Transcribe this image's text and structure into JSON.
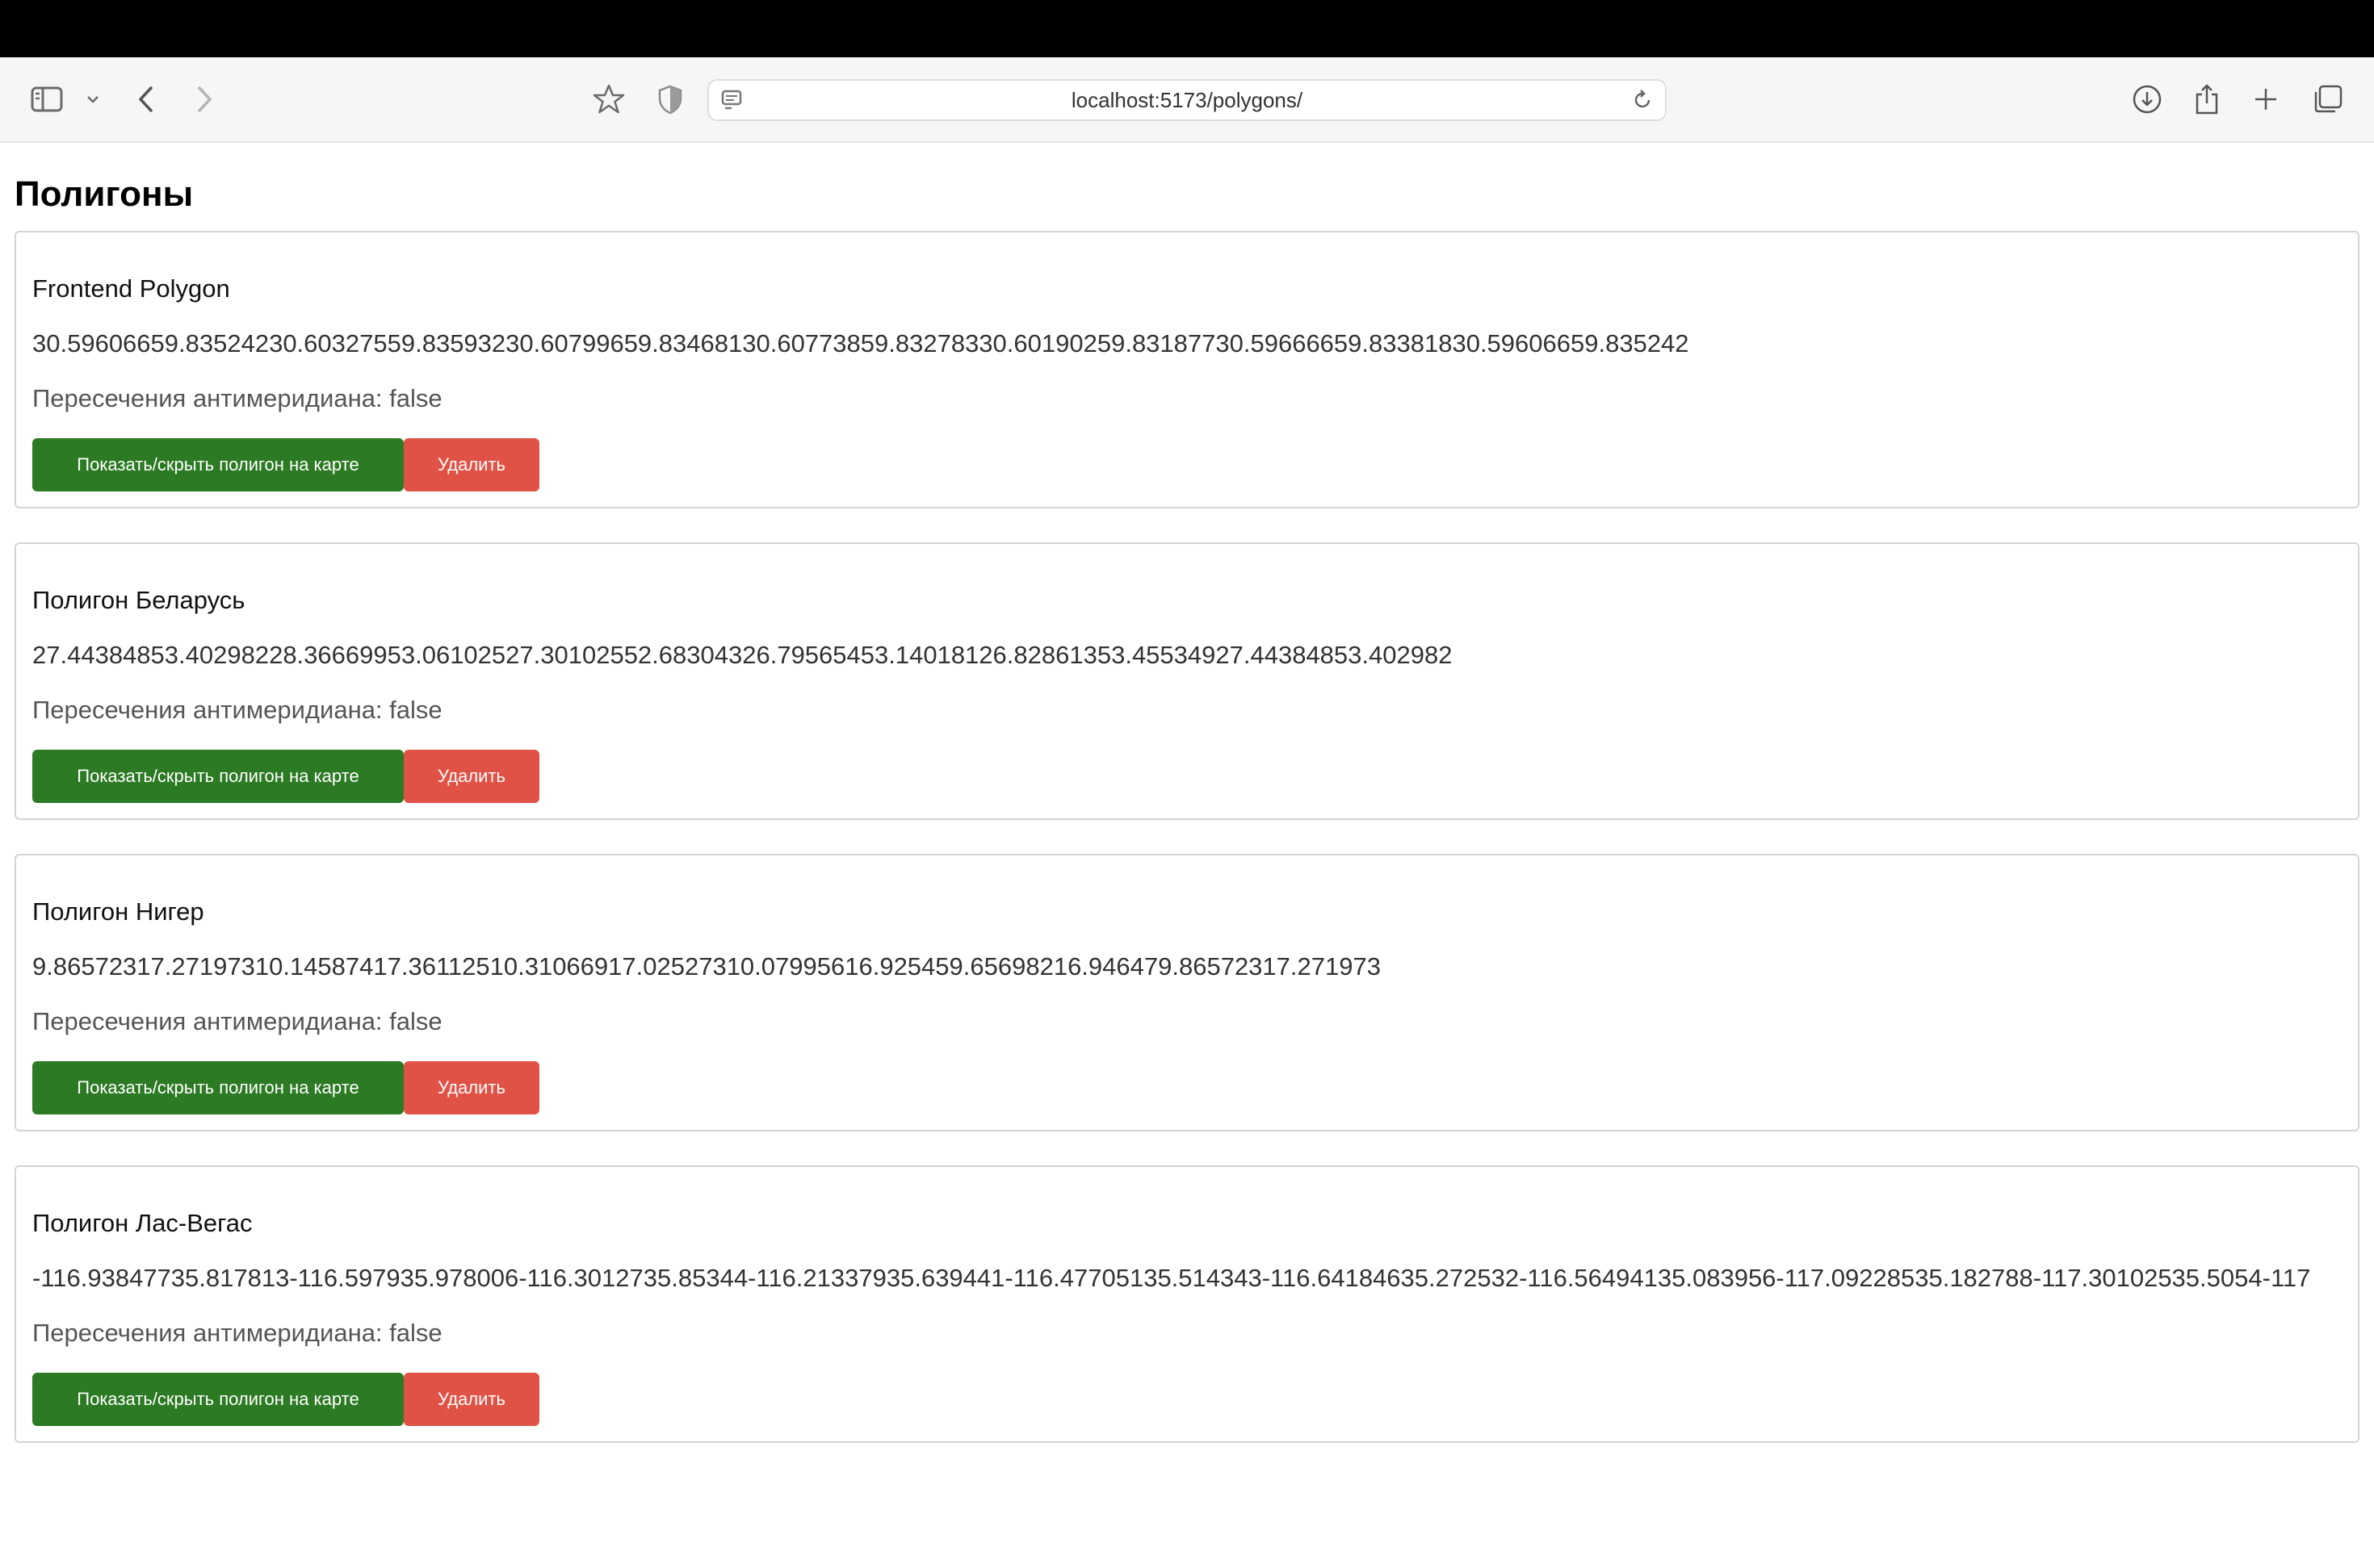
{
  "browser": {
    "url": "localhost:5173/polygons/",
    "icons": {
      "sidebar": "sidebar-icon",
      "chevron": "chevron-down-icon",
      "back": "back-arrow-icon",
      "forward": "forward-arrow-icon",
      "bookmark": "star-icon",
      "shield": "shield-icon",
      "page": "page-icon",
      "reload": "reload-icon",
      "download": "download-icon",
      "share": "share-icon",
      "new_tab": "plus-icon",
      "tabs": "tabs-overview-icon"
    }
  },
  "page": {
    "title": "Полигоны"
  },
  "polygons": [
    {
      "name": "Frontend Polygon",
      "coordinates": "30.59606659.83524230.60327559.83593230.60799659.83468130.60773859.83278330.60190259.83187730.59666659.83381830.59606659.835242",
      "antimeridian": "Пересечения антимеридиана: false",
      "show_label": "Показать/скрыть полигон на карте",
      "delete_label": "Удалить"
    },
    {
      "name": "Полигон Беларусь",
      "coordinates": "27.44384853.40298228.36669953.06102527.30102552.68304326.79565453.14018126.82861353.45534927.44384853.402982",
      "antimeridian": "Пересечения антимеридиана: false",
      "show_label": "Показать/скрыть полигон на карте",
      "delete_label": "Удалить"
    },
    {
      "name": "Полигон Нигер",
      "coordinates": "9.86572317.27197310.14587417.36112510.31066917.02527310.07995616.925459.65698216.946479.86572317.271973",
      "antimeridian": "Пересечения антимеридиана: false",
      "show_label": "Показать/скрыть полигон на карте",
      "delete_label": "Удалить"
    },
    {
      "name": "Полигон Лас-Вегас",
      "coordinates": "-116.93847735.817813-116.597935.978006-116.3012735.85344-116.21337935.639441-116.47705135.514343-116.64184635.272532-116.56494135.083956-117.09228535.182788-117.30102535.5054-117",
      "antimeridian": "Пересечения антимеридиана: false",
      "show_label": "Показать/скрыть полигон на карте",
      "delete_label": "Удалить"
    }
  ],
  "colors": {
    "show_button": "#2d7a24",
    "delete_button": "#e05245"
  }
}
